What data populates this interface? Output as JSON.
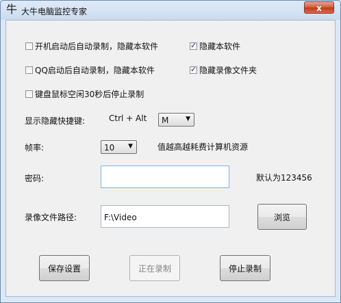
{
  "window": {
    "title": "大牛电脑监控专家",
    "close_label": "x"
  },
  "options": [
    {
      "label": "开机启动后自动录制，隐藏本软件",
      "checked": false
    },
    {
      "label": "隐藏本软件",
      "checked": true
    },
    {
      "label": "QQ启动后自动录制，隐藏本软件",
      "checked": false
    },
    {
      "label": "隐藏录像文件夹",
      "checked": true
    },
    {
      "label": "键盘鼠标空闲30秒后停止录制",
      "checked": false
    }
  ],
  "hotkey": {
    "label": "显示隐藏快捷键:",
    "modifiers": "Ctrl + Alt",
    "key": "M"
  },
  "framerate": {
    "label": "帧率:",
    "value": "10",
    "hint": "值越高越耗费计算机资源"
  },
  "password": {
    "label": "密码:",
    "value": "",
    "default_hint": "默认为123456"
  },
  "path": {
    "label": "录像文件路径:",
    "value": "F:\\Video",
    "browse_label": "浏览"
  },
  "buttons": {
    "save": "保存设置",
    "recording": "正在录制",
    "stop": "停止录制"
  }
}
